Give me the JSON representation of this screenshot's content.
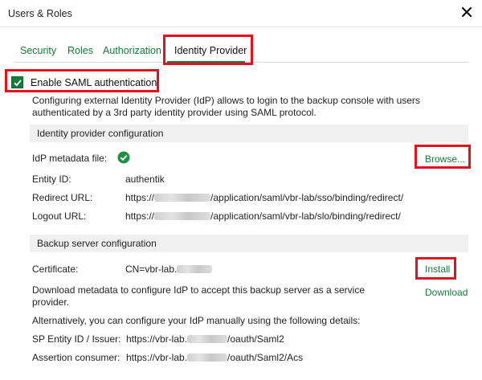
{
  "window": {
    "title": "Users & Roles",
    "close_icon": "close-icon"
  },
  "tabs": [
    {
      "label": "Security"
    },
    {
      "label": "Roles"
    },
    {
      "label": "Authorization"
    },
    {
      "label": "Identity Provider",
      "active": true
    }
  ],
  "saml": {
    "enable_label": "Enable SAML authentication",
    "enabled": true,
    "description": "Configuring external Identity Provider (IdP) allows to login to the backup console with users authenticated by a 3rd party identity provider using SAML protocol."
  },
  "idp_section": {
    "title": "Identity provider configuration",
    "metadata_label": "IdP metadata file:",
    "metadata_status_icon": "check-circle-icon",
    "browse_label": "Browse...",
    "entity_id_label": "Entity ID:",
    "entity_id_value": "authentik",
    "redirect_label": "Redirect URL:",
    "redirect_prefix": "https://",
    "redirect_suffix": "/application/saml/vbr-lab/sso/binding/redirect/",
    "logout_label": "Logout URL:",
    "logout_prefix": "https://",
    "logout_suffix": "/application/saml/vbr-lab/slo/binding/redirect/"
  },
  "backup_section": {
    "title": "Backup server configuration",
    "certificate_label": "Certificate:",
    "certificate_value": "CN=vbr-lab.",
    "install_label": "Install",
    "download_text": "Download metadata to configure IdP to accept this backup server as a service provider.",
    "download_label": "Download",
    "manual_text": "Alternatively, you can configure your IdP manually using the following details:",
    "sp_entity_label": "SP Entity ID / Issuer:",
    "sp_entity_prefix": "https://vbr-lab.",
    "sp_entity_suffix": "/oauth/Saml2",
    "assertion_label": "Assertion consumer:",
    "assertion_prefix": "https://vbr-lab.",
    "assertion_suffix": "/oauth/Saml2/Acs"
  },
  "colors": {
    "accent": "#157a3c",
    "highlight": "#e4101b",
    "section_bg": "#f0f0f0"
  }
}
